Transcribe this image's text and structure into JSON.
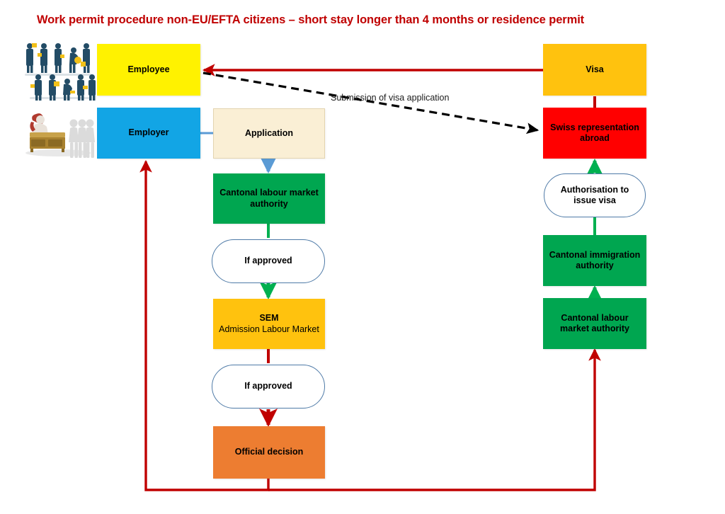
{
  "title": "Work permit procedure non-EU/EFTA citizens – short stay longer than 4 months or residence permit",
  "colors": {
    "title_red": "#C00000",
    "yellow": "#FFF200",
    "blue": "#12A5E5",
    "cream": "#FAEFD5",
    "green": "#00A650",
    "amber": "#FFC20E",
    "red": "#FF0000",
    "orange": "#ED7D31",
    "pill_border": "#4E7AA7",
    "arrow_red": "#C00000",
    "arrow_green": "#00B050",
    "arrow_blue": "#5B9BD5",
    "arrow_black": "#000000"
  },
  "chart_data": {
    "type": "diagram",
    "title": "Work permit procedure non-EU/EFTA citizens – short stay longer than 4 months or residence permit",
    "nodes": [
      {
        "id": "employee",
        "label": "Employee",
        "shape": "rect",
        "color": "#FFF200",
        "column": "left"
      },
      {
        "id": "employer",
        "label": "Employer",
        "shape": "rect",
        "color": "#12A5E5",
        "column": "left"
      },
      {
        "id": "application",
        "label": "Application",
        "shape": "rect",
        "color": "#FAEFD5",
        "column": "middle"
      },
      {
        "id": "cantonal_labour",
        "label": "Cantonal labour market authority",
        "shape": "rect",
        "color": "#00A650",
        "column": "middle"
      },
      {
        "id": "if_approved_1",
        "label": "If approved",
        "shape": "pill",
        "color": "#FFFFFF",
        "column": "middle"
      },
      {
        "id": "sem",
        "label": "SEM Admission Labour Market",
        "shape": "rect",
        "color": "#FFC20E",
        "column": "middle"
      },
      {
        "id": "if_approved_2",
        "label": "If approved",
        "shape": "pill",
        "color": "#FFFFFF",
        "column": "middle"
      },
      {
        "id": "official",
        "label": "Official decision",
        "shape": "rect",
        "color": "#ED7D31",
        "column": "middle"
      },
      {
        "id": "visa",
        "label": "Visa",
        "shape": "rect",
        "color": "#FFC20E",
        "column": "right"
      },
      {
        "id": "swiss_rep",
        "label": "Swiss representation abroad",
        "shape": "rect",
        "color": "#FF0000",
        "column": "right"
      },
      {
        "id": "authorisation",
        "label": "Authorisation to issue visa",
        "shape": "pill",
        "color": "#FFFFFF",
        "column": "right"
      },
      {
        "id": "cantonal_immig",
        "label": "Cantonal immigration authority",
        "shape": "rect",
        "color": "#00A650",
        "column": "right"
      },
      {
        "id": "cantonal_labour_r",
        "label": "Cantonal labour market authority",
        "shape": "rect",
        "color": "#00A650",
        "column": "right"
      }
    ],
    "edges": [
      {
        "from": "employer",
        "to": "application",
        "color": "#5B9BD5",
        "style": "solid",
        "arrow": false
      },
      {
        "from": "application",
        "to": "cantonal_labour",
        "color": "#5B9BD5",
        "style": "solid",
        "arrow": true
      },
      {
        "from": "cantonal_labour",
        "to": "if_approved_1",
        "color": "#00B050",
        "style": "solid",
        "arrow": false
      },
      {
        "from": "if_approved_1",
        "to": "sem",
        "color": "#00B050",
        "style": "solid",
        "arrow": true
      },
      {
        "from": "sem",
        "to": "if_approved_2",
        "color": "#C00000",
        "style": "solid",
        "arrow": false
      },
      {
        "from": "if_approved_2",
        "to": "official",
        "color": "#C00000",
        "style": "solid",
        "arrow": true
      },
      {
        "from": "official",
        "to": "employer",
        "color": "#C00000",
        "style": "solid",
        "arrow": true
      },
      {
        "from": "official",
        "to": "cantonal_labour_r",
        "color": "#C00000",
        "style": "solid",
        "arrow": true
      },
      {
        "from": "cantonal_labour_r",
        "to": "cantonal_immig",
        "color": "#00B050",
        "style": "solid",
        "arrow": true
      },
      {
        "from": "cantonal_immig",
        "to": "authorisation",
        "color": "#00B050",
        "style": "solid",
        "arrow": false
      },
      {
        "from": "authorisation",
        "to": "swiss_rep",
        "color": "#00B050",
        "style": "solid",
        "arrow": true
      },
      {
        "from": "swiss_rep",
        "to": "visa",
        "color": "#C00000",
        "style": "solid",
        "arrow": false
      },
      {
        "from": "visa",
        "to": "employee",
        "color": "#C00000",
        "style": "solid",
        "arrow": true
      },
      {
        "from": "employee",
        "to": "swiss_rep",
        "color": "#000000",
        "style": "dashed",
        "arrow": true,
        "label": "Submission of visa application"
      }
    ]
  },
  "nodes": {
    "employee": "Employee",
    "employer": "Employer",
    "application": "Application",
    "cantonal_labour": "Cantonal labour market authority",
    "if_approved_1": "If approved",
    "sem_title": "SEM",
    "sem_sub": "Admission Labour Market",
    "if_approved_2": "If approved",
    "official_decision": "Official decision",
    "visa": "Visa",
    "swiss_rep": "Swiss representation abroad",
    "authorisation": "Authorisation to issue visa",
    "cantonal_immigration": "Cantonal immigration authority",
    "cantonal_labour_right": "Cantonal labour market authority"
  },
  "edge_labels": {
    "submission": "Submission of visa application"
  },
  "images": {
    "workers": "workers-clipart",
    "interview": "interview-desk-clipart"
  }
}
